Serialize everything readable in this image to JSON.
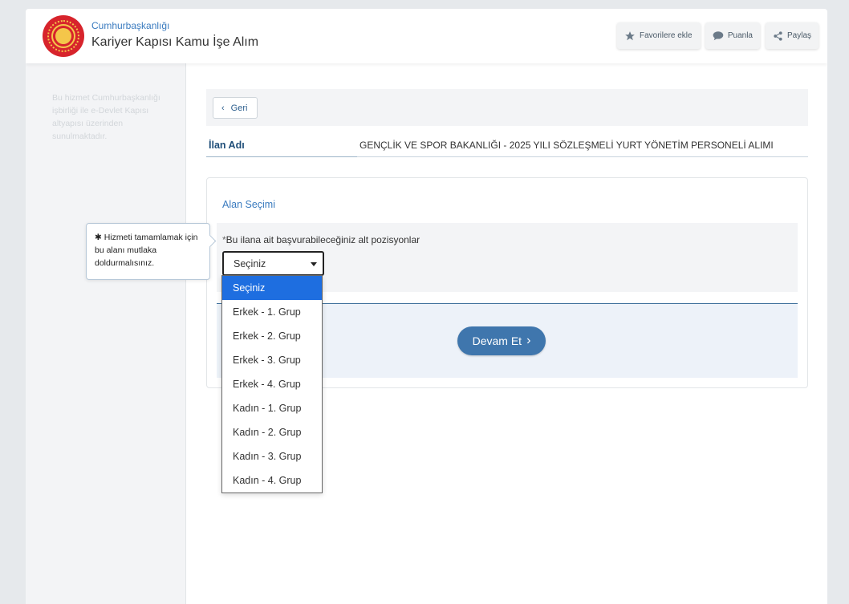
{
  "header": {
    "organization": "Cumhurbaşkanlığı",
    "service_title": "Kariyer Kapısı Kamu İşe Alım",
    "buttons": {
      "favorite": "Favorilere ekle",
      "rate": "Puanla",
      "share": "Paylaş"
    }
  },
  "sidebar": {
    "note": "Bu hizmet Cumhurbaşkanlığı işbirliği ile e-Devlet Kapısı altyapısı üzerinden sunulmaktadır."
  },
  "back_button": {
    "label": "Geri"
  },
  "listing": {
    "label": "İlan Adı",
    "value": "GENÇLİK VE SPOR BAKANLIĞI - 2025 YILI SÖZLEŞMELİ YURT YÖNETİM PERSONELİ ALIMI"
  },
  "area_selection": {
    "title": "Alan Seçimi",
    "required_marker": "*",
    "field_label": "Bu ilana ait başvurabileceğiniz alt pozisyonlar",
    "selected_value": "Seçiniz",
    "options": [
      "Seçiniz",
      "Erkek - 1. Grup",
      "Erkek - 2. Grup",
      "Erkek - 3. Grup",
      "Erkek - 4. Grup",
      "Kadın - 1. Grup",
      "Kadın - 2. Grup",
      "Kadın - 3. Grup",
      "Kadın - 4. Grup"
    ]
  },
  "tooltip": {
    "text": "✱ Hizmeti tamamlamak için bu alanı mutlaka doldurmalısınız."
  },
  "submit": {
    "label": "Devam Et"
  },
  "colors": {
    "accent": "#3f76ad",
    "link": "#3a7bbf",
    "selected_option": "#1e6ee0",
    "logo_red": "#d7242c",
    "logo_gold": "#f4c64a"
  },
  "icons": [
    "star-icon",
    "speech-bubble-icon",
    "share-icon",
    "chevron-left-icon",
    "chevron-right-icon",
    "caret-down-icon"
  ]
}
